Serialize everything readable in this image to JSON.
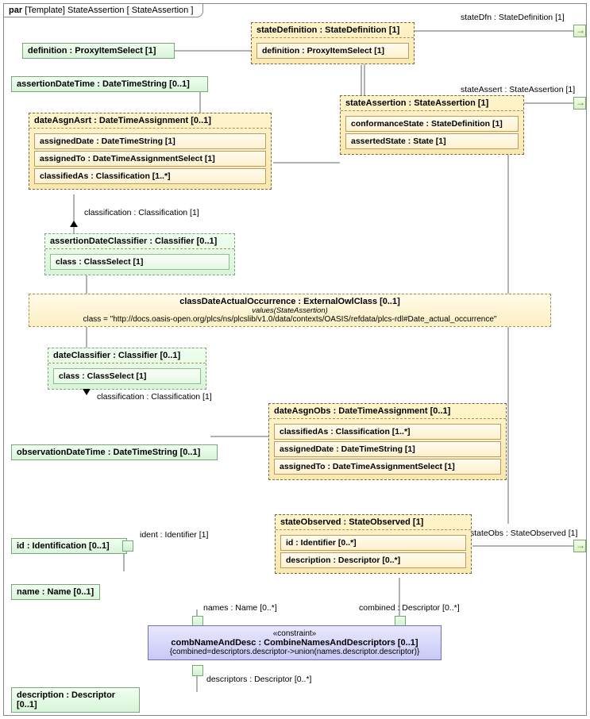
{
  "frame": {
    "kind": "par",
    "stereo": "[Template]",
    "name": "StateAssertion",
    "ref": "[ StateAssertion ]"
  },
  "ports": {
    "stateDfn": "stateDfn : StateDefinition [1]",
    "stateAssert": "stateAssert : StateAssertion [1]",
    "stateObs": "stateObs : StateObserved [1]"
  },
  "blocks": {
    "definition": "definition : ProxyItemSelect [1]",
    "stateDefinition": {
      "title": "stateDefinition : StateDefinition [1]",
      "row1": "definition : ProxyItemSelect [1]"
    },
    "assertionDateTime": "assertionDateTime : DateTimeString [0..1]",
    "dateAsgnAsrt": {
      "title": "dateAsgnAsrt : DateTimeAssignment [0..1]",
      "r1": "assignedDate : DateTimeString [1]",
      "r2": "assignedTo : DateTimeAssignmentSelect [1]",
      "r3": "classifiedAs : Classification [1..*]"
    },
    "stateAssertion": {
      "title": "stateAssertion : StateAssertion [1]",
      "r1": "conformanceState : StateDefinition [1]",
      "r2": "assertedState : State [1]"
    },
    "assertionDateClassifier": {
      "title": "assertionDateClassifier : Classifier [0..1]",
      "r1": "class : ClassSelect [1]"
    },
    "classDateActualOccurrence": {
      "title": "classDateActualOccurrence : ExternalOwlClass [0..1]",
      "sub": "values(StateAssertion)",
      "val": "class = \"http://docs.oasis-open.org/plcs/ns/plcslib/v1.0/data/contexts/OASIS/refdata/plcs-rdl#Date_actual_occurrence\""
    },
    "dateClassifier": {
      "title": "dateClassifier : Classifier [0..1]",
      "r1": "class : ClassSelect [1]"
    },
    "dateAsgnObs": {
      "title": "dateAsgnObs : DateTimeAssignment [0..1]",
      "r1": "classifiedAs : Classification [1..*]",
      "r2": "assignedDate : DateTimeString [1]",
      "r3": "assignedTo : DateTimeAssignmentSelect [1]"
    },
    "observationDateTime": "observationDateTime : DateTimeString [0..1]",
    "stateObserved": {
      "title": "stateObserved : StateObserved [1]",
      "r1": "id : Identifier [0..*]",
      "r2": "description : Descriptor [0..*]"
    },
    "id": "id : Identification [0..1]",
    "name": "name : Name [0..1]",
    "description": "description : Descriptor [0..1]"
  },
  "constraint": {
    "stereo": "«constraint»",
    "title": "combNameAndDesc : CombineNamesAndDescriptors [0..1]",
    "body": "{combined=descriptors.descriptor->union(names.descriptor.descriptor)}"
  },
  "edgeLabels": {
    "classification1": "classification : Classification [1]",
    "classification2": "classification : Classification [1]",
    "ident": "ident : Identifier [1]",
    "names": "names : Name [0..*]",
    "combined": "combined : Descriptor [0..*]",
    "descriptors": "descriptors : Descriptor [0..*]"
  }
}
